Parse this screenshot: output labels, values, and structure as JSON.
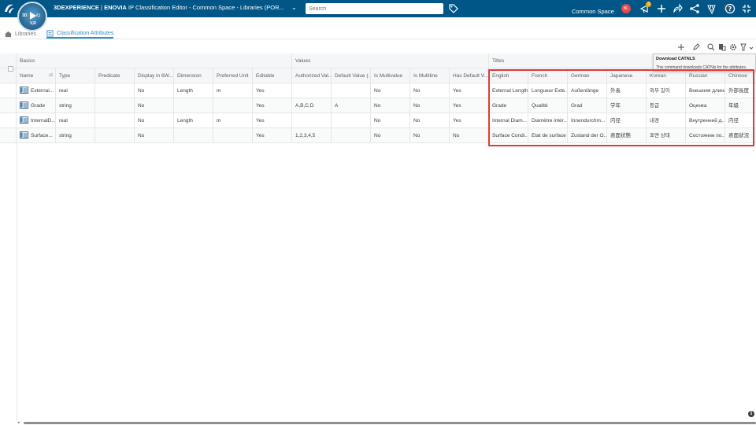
{
  "topbar": {
    "brand_prefix": "3DEXPERIENCE",
    "brand_app": "ENOVIA",
    "app_title": "IP Classification Editor - Common Space - Libraries (POR...",
    "search_placeholder": "Search",
    "space_label": "Common Space",
    "avatar_initials": "BL",
    "notification_count": "3",
    "compass_labels": {
      "left": "3D",
      "right": "iQ",
      "bottom": "V,R"
    },
    "icons": [
      "tag-icon",
      "notification-icon",
      "add-icon",
      "share-icon",
      "network-icon",
      "apps-icon",
      "help-icon",
      "collapse-icon"
    ]
  },
  "tabs": [
    {
      "label": "Libraries",
      "icon": "library-icon",
      "active": false
    },
    {
      "label": "Classification Attributes",
      "icon": "attributes-icon",
      "active": true
    }
  ],
  "toolbar": {
    "icons": [
      "add-icon",
      "edit-icon",
      "search-icon",
      "download-icon",
      "settings-icon",
      "filter-icon"
    ]
  },
  "tooltip": {
    "title": "Download CATNLS",
    "body": "This command downloads CATNls for the attributes."
  },
  "grid": {
    "groups": [
      "Basics",
      "Values",
      "Titles"
    ],
    "headers": [
      "Name",
      "Type",
      "Predicate",
      "Display in 6W...",
      "Dimension",
      "Preferred Unit",
      "Editable",
      "Authorized Val...",
      "Default Value (...",
      "Is Multivalue",
      "Is Multiline",
      "Has Default V...",
      "English",
      "French",
      "German",
      "Japanese",
      "Korean",
      "Russian",
      "Chinese"
    ],
    "rows": [
      [
        "External...",
        "real",
        "",
        "No",
        "Length",
        "m",
        "Yes",
        "",
        "",
        "No",
        "No",
        "Yes",
        "External Length",
        "Longueur Exte...",
        "Außenlänge",
        "外長",
        "외부 길이",
        "Внешняя длина",
        "外部長度"
      ],
      [
        "Grade",
        "string",
        "",
        "No",
        "",
        "",
        "Yes",
        "A,B,C,D",
        "A",
        "No",
        "No",
        "Yes",
        "Grade",
        "Qualité",
        "Grad",
        "学年",
        "등급",
        "Оценка",
        "年級"
      ],
      [
        "InternalD...",
        "real",
        "",
        "No",
        "Length",
        "m",
        "Yes",
        "",
        "",
        "No",
        "No",
        "Yes",
        "Internal Diam...",
        "Diamètre intér...",
        "Innendurchm...",
        "内径",
        "내경",
        "Внутренний д...",
        "内径"
      ],
      [
        "Surface...",
        "string",
        "",
        "No",
        "",
        "",
        "Yes",
        "1,2,3,4,5",
        "",
        "No",
        "No",
        "No",
        "Surface Condi...",
        "Etat de surface",
        "Zustand der O...",
        "表面状態",
        "표면 상태",
        "Состояние по...",
        "表面狀況"
      ]
    ]
  },
  "colors": {
    "topbar": "#005686",
    "accent": "#368ec4",
    "highlight": "#e03a3a"
  }
}
